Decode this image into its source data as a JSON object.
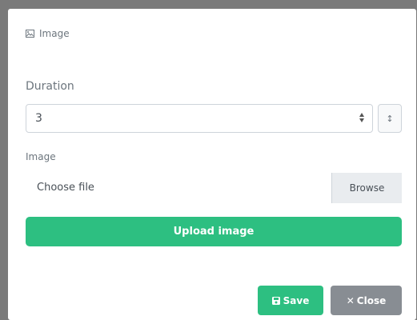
{
  "modal": {
    "title": "Image",
    "title_icon": "image-icon"
  },
  "form": {
    "duration_label": "Duration",
    "duration_value": "3",
    "side_button_label": "↕",
    "image_label": "Image",
    "file_placeholder": "Choose file",
    "browse_label": "Browse",
    "upload_label": "Upload image"
  },
  "footer": {
    "save_label": "Save",
    "save_icon": "floppy-icon",
    "close_label": "Close",
    "close_icon": "close-icon"
  },
  "colors": {
    "accent_green": "#2dbf81",
    "secondary_gray": "#888d93",
    "label_gray": "#6c757d"
  }
}
